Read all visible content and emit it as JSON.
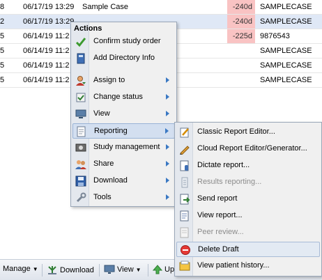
{
  "table": {
    "rows": [
      {
        "num": "8",
        "date": "06/17/19 13:29",
        "desc": "Sample Case",
        "days": "-240d",
        "pid": "SAMPLECASE",
        "overdue": true,
        "selected": false
      },
      {
        "num": "2",
        "date": "06/17/19 13:29",
        "desc": "",
        "days": "-240d",
        "pid": "SAMPLECASE",
        "overdue": true,
        "selected": true
      },
      {
        "num": "5",
        "date": "06/14/19 11:2",
        "desc": "",
        "days": "-225d",
        "pid": "9876543",
        "overdue": true,
        "selected": false
      },
      {
        "num": "5",
        "date": "06/14/19 11:2",
        "desc": "",
        "days": "",
        "pid": "SAMPLECASE",
        "overdue": false,
        "selected": false
      },
      {
        "num": "5",
        "date": "06/14/19 11:2",
        "desc": "",
        "days": "",
        "pid": "SAMPLECASE",
        "overdue": false,
        "selected": false
      },
      {
        "num": "5",
        "date": "06/14/19 11:2",
        "desc": "",
        "days": "",
        "pid": "SAMPLECASE",
        "overdue": false,
        "selected": false
      }
    ]
  },
  "actions_menu": {
    "title": "Actions",
    "items": [
      {
        "label": "Confirm study order",
        "icon": "checkmark-icon"
      },
      {
        "label": "Add Directory Info",
        "icon": "directory-book-icon"
      },
      {
        "label": "Assign to",
        "icon": "assign-user-icon",
        "submenu": true
      },
      {
        "label": "Change status",
        "icon": "status-icon",
        "submenu": true
      },
      {
        "label": "View",
        "icon": "monitor-icon",
        "submenu": true
      },
      {
        "label": "Reporting",
        "icon": "reporting-icon",
        "submenu": true
      },
      {
        "label": "Study management",
        "icon": "study-management-icon",
        "submenu": true
      },
      {
        "label": "Share",
        "icon": "share-users-icon",
        "submenu": true
      },
      {
        "label": "Download",
        "icon": "download-disk-icon",
        "submenu": true
      },
      {
        "label": "Tools",
        "icon": "wrench-icon",
        "submenu": true
      }
    ]
  },
  "reporting_menu": {
    "items": [
      {
        "label": "Classic Report Editor...",
        "icon": "classic-editor-icon",
        "disabled": false
      },
      {
        "label": "Cloud Report Editor/Generator...",
        "icon": "cloud-editor-pencil-icon",
        "disabled": false
      },
      {
        "label": "Dictate report...",
        "icon": "dictate-icon",
        "disabled": false
      },
      {
        "label": "Results reporting...",
        "icon": "results-report-icon",
        "disabled": true
      },
      {
        "label": "Send report",
        "icon": "send-report-icon",
        "disabled": false
      },
      {
        "label": "View report...",
        "icon": "view-report-icon",
        "disabled": false
      },
      {
        "label": "Peer review...",
        "icon": "peer-review-icon",
        "disabled": true
      },
      {
        "label": "Delete Draft",
        "icon": "delete-draft-icon",
        "disabled": false
      },
      {
        "label": "View patient history...",
        "icon": "patient-history-icon",
        "disabled": false
      }
    ]
  },
  "toolbar": {
    "manage_label": "Manage",
    "download_label": "Download",
    "view_label": "View",
    "up_label": "Up"
  },
  "colors": {
    "overdue_bg": "#f9c3c3",
    "selected_row_bg": "#dfe8f6",
    "submenu_arrow": "#3a78c3"
  }
}
